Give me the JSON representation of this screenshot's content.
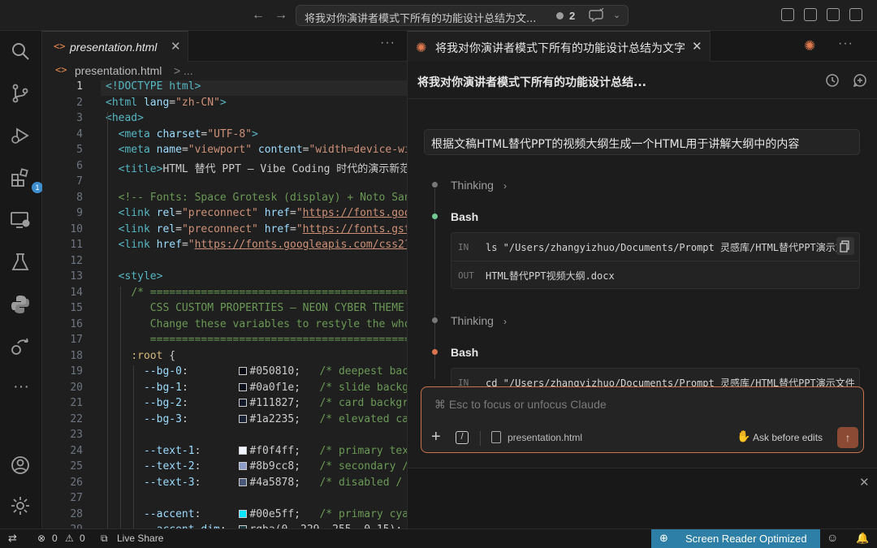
{
  "titlebar": {
    "command_center_text": "将我对你演讲者模式下所有的功能设计总结为文...",
    "pending_count": "2"
  },
  "activity_bar": {
    "extensions_badge": "1"
  },
  "editor": {
    "tab_icon": "<>",
    "tab_label": "presentation.html",
    "breadcrumb_file": "presentation.html",
    "breadcrumb_sep": ">",
    "breadcrumb_tail": "...",
    "active_line": 1,
    "lines": [
      {
        "n": "1",
        "html": "<span class=\"tag\">&lt;!DOCTYPE html&gt;</span>"
      },
      {
        "n": "2",
        "html": "<span class=\"tag\">&lt;html</span> <span class=\"attr\">lang</span>=<span class=\"str\">\"zh-CN\"</span><span class=\"tag\">&gt;</span>"
      },
      {
        "n": "3",
        "html": "<span class=\"tag\">&lt;head&gt;</span>"
      },
      {
        "n": "4",
        "html": "  <span class=\"tag\">&lt;meta</span> <span class=\"attr\">charset</span>=<span class=\"str\">\"UTF-8\"</span><span class=\"tag\">&gt;</span>"
      },
      {
        "n": "5",
        "html": "  <span class=\"tag\">&lt;meta</span> <span class=\"attr\">name</span>=<span class=\"str\">\"viewport\"</span> <span class=\"attr\">content</span>=<span class=\"str\">\"width=device-wi</span>"
      },
      {
        "n": "6",
        "html": "  <span class=\"tag\">&lt;title&gt;</span>HTML 替代 PPT — Vibe Coding 时代的演示新范"
      },
      {
        "n": "7",
        "html": ""
      },
      {
        "n": "8",
        "html": "  <span class=\"cmt\">&lt;!-- Fonts: Space Grotesk (display) + Noto San</span>"
      },
      {
        "n": "9",
        "html": "  <span class=\"tag\">&lt;link</span> <span class=\"attr\">rel</span>=<span class=\"str\">\"preconnect\"</span> <span class=\"attr\">href</span>=<span class=\"str\">\"<span class=\"lnk\">https://fonts.goo</span></span>"
      },
      {
        "n": "10",
        "html": "  <span class=\"tag\">&lt;link</span> <span class=\"attr\">rel</span>=<span class=\"str\">\"preconnect\"</span> <span class=\"attr\">href</span>=<span class=\"str\">\"<span class=\"lnk\">https://fonts.gst</span></span>"
      },
      {
        "n": "11",
        "html": "  <span class=\"tag\">&lt;link</span> <span class=\"attr\">href</span>=<span class=\"str\">\"<span class=\"lnk\">https://fonts.googleapis.com/css2?</span></span>"
      },
      {
        "n": "12",
        "html": ""
      },
      {
        "n": "13",
        "html": "  <span class=\"tag\">&lt;style&gt;</span>"
      },
      {
        "n": "14",
        "html": "    <span class=\"cmt\">/* ==============================================</span>"
      },
      {
        "n": "15",
        "html": "<span class=\"cmt\">       CSS CUSTOM PROPERTIES — NEON CYBER THEME</span>"
      },
      {
        "n": "16",
        "html": "<span class=\"cmt\">       Change these variables to restyle the who</span>"
      },
      {
        "n": "17",
        "html": "<span class=\"cmt\">       ===========================================</span>"
      },
      {
        "n": "18",
        "html": "    <span class=\"sel\">:root</span> {"
      },
      {
        "n": "19",
        "html": "      <span class=\"var\">--bg-0</span>:        <i class=\"sw\" style=\"background:#050810\"></i>#050810;   <span class=\"cmt\">/* deepest bac</span>"
      },
      {
        "n": "20",
        "html": "      <span class=\"var\">--bg-1</span>:        <i class=\"sw\" style=\"background:#0a0f1e\"></i>#0a0f1e;   <span class=\"cmt\">/* slide backg</span>"
      },
      {
        "n": "21",
        "html": "      <span class=\"var\">--bg-2</span>:        <i class=\"sw\" style=\"background:#111827\"></i>#111827;   <span class=\"cmt\">/* card backgr</span>"
      },
      {
        "n": "22",
        "html": "      <span class=\"var\">--bg-3</span>:        <i class=\"sw\" style=\"background:#1a2235\"></i>#1a2235;   <span class=\"cmt\">/* elevated ca</span>"
      },
      {
        "n": "23",
        "html": ""
      },
      {
        "n": "24",
        "html": "      <span class=\"var\">--text-1</span>:      <i class=\"sw\" style=\"background:#f0f4ff\"></i>#f0f4ff;   <span class=\"cmt\">/* primary tex</span>"
      },
      {
        "n": "25",
        "html": "      <span class=\"var\">--text-2</span>:      <i class=\"sw\" style=\"background:#8b9cc8\"></i>#8b9cc8;   <span class=\"cmt\">/* secondary /</span>"
      },
      {
        "n": "26",
        "html": "      <span class=\"var\">--text-3</span>:      <i class=\"sw\" style=\"background:#4a5878\"></i>#4a5878;   <span class=\"cmt\">/* disabled / </span>"
      },
      {
        "n": "27",
        "html": ""
      },
      {
        "n": "28",
        "html": "      <span class=\"var\">--accent</span>:      <i class=\"sw\" style=\"background:#00e5ff\"></i>#00e5ff;   <span class=\"cmt\">/* primary cya</span>"
      },
      {
        "n": "29",
        "html": "      <span class=\"var\">--accent-dim</span>:  <i class=\"sw\" style=\"background:#00e5ff26\"></i>rgba(0, 229, 255, 0.15);"
      }
    ]
  },
  "claude": {
    "tab_label": "将我对你演讲者模式下所有的功能设计总结为文字",
    "header_title": "将我对你演讲者模式下所有的功能设计总结...",
    "user_message": "根据文稿HTML替代PPT的视频大纲生成一个HTML用于讲解大纲中的内容",
    "thinking_label": "Thinking",
    "bash_label": "Bash",
    "in_label": "IN",
    "out_label": "OUT",
    "bash1_in": "ls \"/Users/zhangyizhuo/Documents/Prompt 灵感库/HTML替代PPT演示文",
    "bash1_out": "HTML替代PPT视频大纲.docx",
    "bash2_in": "cd \"/Users/zhangyizhuo/Documents/Prompt 灵感库/HTML替代PPT演示文件",
    "composer_placeholder": "⌘ Esc to focus or unfocus Claude",
    "composer_file": "presentation.html",
    "composer_mode": "Ask before edits",
    "colors": {
      "accent": "#e07a4f",
      "dot_green": "#73c991",
      "dot_orange": "#d9734e"
    }
  },
  "statusbar": {
    "errors": "0",
    "warnings": "0",
    "live_share": "Live Share",
    "screen_reader": "Screen Reader Optimized"
  }
}
